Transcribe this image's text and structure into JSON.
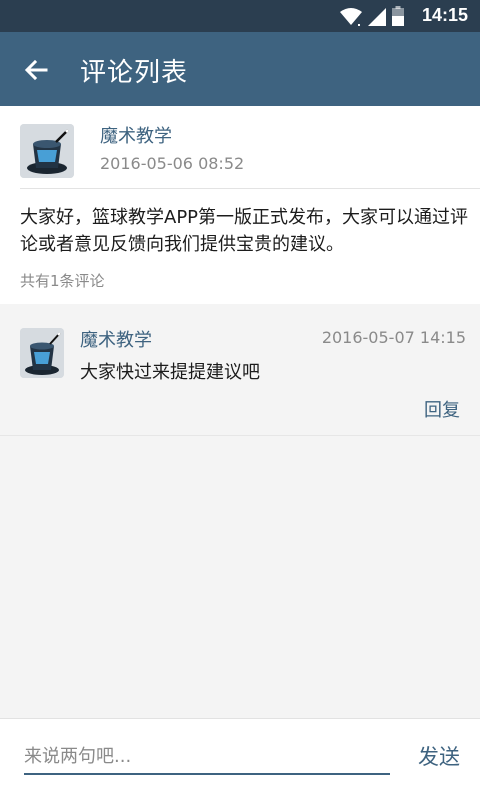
{
  "status_bar": {
    "time": "14:15",
    "icons": [
      "wifi-icon",
      "signal-icon",
      "battery-icon"
    ]
  },
  "app_bar": {
    "title": "评论列表",
    "back_icon": "arrow-left-icon"
  },
  "post": {
    "author": "魔术教学",
    "date": "2016-05-06 08:52",
    "content": "大家好，篮球教学APP第一版正式发布，大家可以通过评论或者意见反馈向我们提供宝贵的建议。",
    "comment_count": "共有1条评论",
    "avatar_icon": "magic-hat-icon"
  },
  "comments": [
    {
      "author": "魔术教学",
      "date": "2016-05-07 14:15",
      "text": "大家快过来提提建议吧",
      "reply_label": "回复",
      "avatar_icon": "magic-hat-icon"
    }
  ],
  "input_bar": {
    "placeholder": "来说两句吧...",
    "value": "",
    "send_label": "发送"
  },
  "colors": {
    "status_bar": "#2b3e50",
    "app_bar": "#3e6380",
    "accent": "#3e6380",
    "muted": "#8a8a8a"
  }
}
